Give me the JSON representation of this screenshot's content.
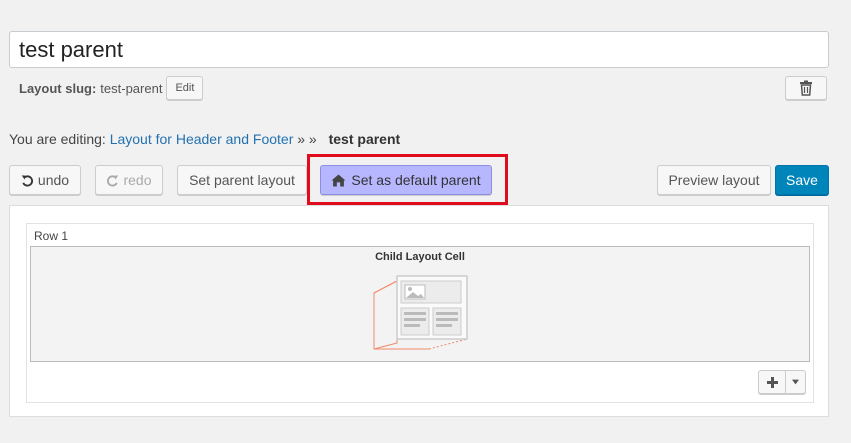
{
  "layout": {
    "title": "test parent",
    "slug_label": "Layout slug:",
    "slug_value": "test-parent",
    "edit_label": "Edit"
  },
  "breadcrumb": {
    "prefix": "You are editing:",
    "link": "Layout for Header and Footer",
    "separator": "» »",
    "current": "test parent"
  },
  "toolbar": {
    "undo_label": "undo",
    "redo_label": "redo",
    "set_parent_label": "Set parent layout",
    "set_default_label": "Set as default parent",
    "preview_label": "Preview layout",
    "save_label": "Save"
  },
  "editor": {
    "row_label": "Row 1",
    "cell_title": "Child Layout Cell"
  },
  "icons": {
    "undo": "undo-icon",
    "redo": "redo-icon",
    "home": "home-icon",
    "trash": "trash-icon",
    "add": "plus-icon",
    "dropdown": "caret-down-icon",
    "illustration": "child-layout-illustration"
  },
  "colors": {
    "primary": "#0085ba",
    "highlight_border": "#e00b1c",
    "default_parent_button": "#b7b7ff",
    "link": "#2271b1",
    "illustration_accent": "#f08a6a"
  }
}
